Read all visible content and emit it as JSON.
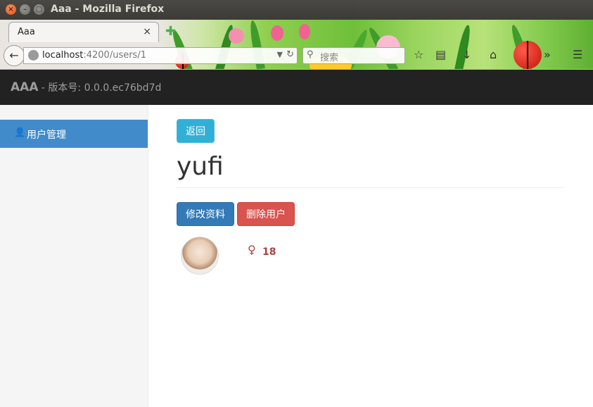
{
  "window": {
    "title": "Aaa - Mozilla Firefox"
  },
  "browser": {
    "tab_label": "Aaa",
    "tab_close": "×",
    "new_tab": "✚",
    "url_host": "localhost",
    "url_path": ":4200/users/1",
    "search_placeholder": "搜索"
  },
  "app": {
    "brand_name": "AAA",
    "brand_version": " - 版本号: 0.0.0.ec76bd7d"
  },
  "sidebar": {
    "items": [
      {
        "label": "用户管理",
        "icon": "user-icon"
      }
    ]
  },
  "user": {
    "back_label": "返回",
    "name": "yufi",
    "edit_label": "修改资料",
    "delete_label": "删除用户",
    "gender_symbol": "♀",
    "age": "18"
  },
  "colors": {
    "navbar": "#222222",
    "primary": "#337ab7",
    "danger": "#d9534f",
    "info": "#31b0d5",
    "active_sidebar": "#428bca"
  }
}
